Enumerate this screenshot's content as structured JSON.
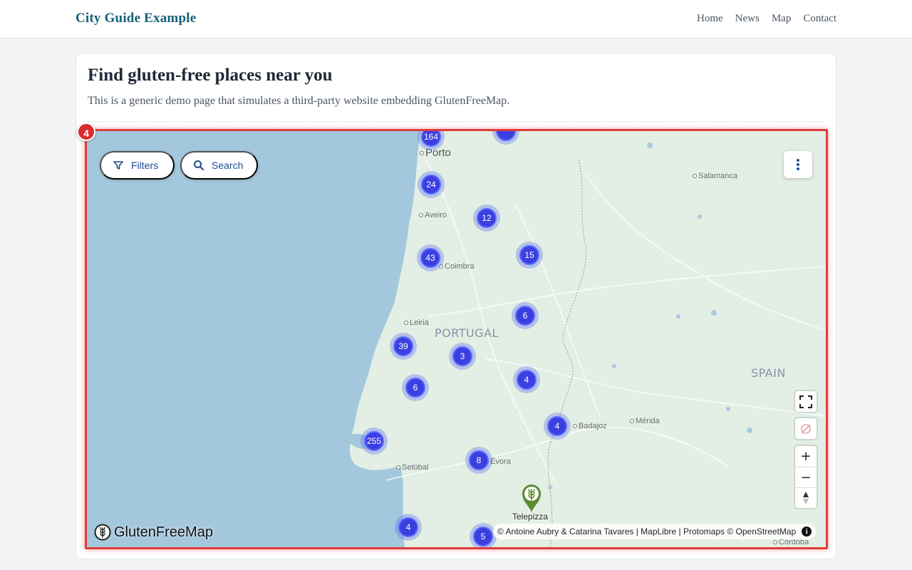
{
  "site": {
    "brand": "City Guide Example",
    "nav": [
      "Home",
      "News",
      "Map",
      "Contact"
    ]
  },
  "page": {
    "title": "Find gluten-free places near you",
    "subtitle": "This is a generic demo page that simulates a third-party website embedding GlutenFreeMap."
  },
  "annotation": {
    "badge": "4",
    "highlight_color": "#e03b3b"
  },
  "map": {
    "filters_label": "Filters",
    "search_label": "Search",
    "logo_text": "GlutenFreeMap",
    "attribution": "© Antoine Aubry & Catarina Tavares | MapLibre | Protomaps © OpenStreetMap",
    "countries": [
      "PORTUGAL",
      "SPAIN"
    ],
    "cities": [
      "Porto",
      "Aveiro",
      "Coimbra",
      "Leiria",
      "Setúbal",
      "Évora",
      "Badajoz",
      "Mérida",
      "Salamanca",
      "Córdoba"
    ],
    "clusters": [
      "164",
      "24",
      "12",
      "43",
      "15",
      "6",
      "39",
      "3",
      "4",
      "6",
      "4",
      "255",
      "8",
      "4",
      "5"
    ],
    "place_marker": "Telepizza",
    "colors": {
      "water": "#a3c8de",
      "land": "#e3efe4",
      "cluster": "#3b3fe0",
      "pin": "#5b8a2f"
    },
    "controls": [
      "fullscreen-icon",
      "geolocate-icon",
      "zoom-in-icon",
      "zoom-out-icon",
      "compass-icon"
    ]
  }
}
